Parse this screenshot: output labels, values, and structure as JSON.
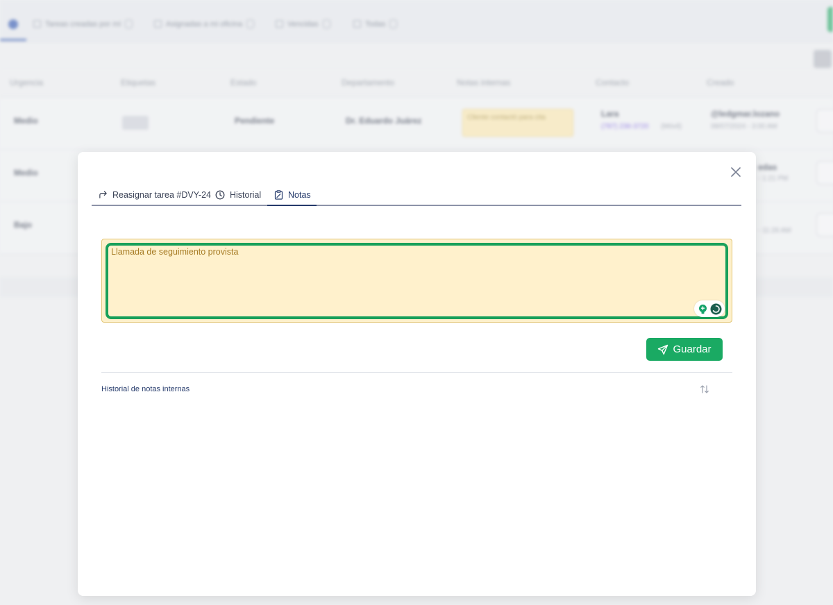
{
  "background": {
    "tabs": [
      {
        "label": "Tareas creadas por mí"
      },
      {
        "label": "Asignadas a mi oficina"
      },
      {
        "label": "Vencidas"
      },
      {
        "label": "Todas"
      }
    ],
    "columns": [
      "Urgencia",
      "Etiquetas",
      "Estado",
      "Departamento",
      "Notas internas",
      "Contacto",
      "Creado"
    ],
    "rows": [
      {
        "urgency": "Medio",
        "status": "Pendiente",
        "department": "Dr. Eduardo Juárez",
        "note": "Cliente contactó para cita",
        "contact": "Lara",
        "phone": "(787) 236-3720",
        "phone_suffix": "(Móvil)",
        "creator": "@ledgmar.lozano",
        "created": "08/07/2024 - 3:00 AM"
      },
      {
        "urgency": "Medio",
        "creator": "edas",
        "created": "- 1:21 PM"
      },
      {
        "urgency": "Bajo",
        "created": "- 11:26 AM"
      }
    ]
  },
  "modal": {
    "tabs": [
      {
        "label": "Reasignar tarea #DVY-24",
        "icon": "forward-arrow-icon"
      },
      {
        "label": "Historial",
        "icon": "clock-icon"
      },
      {
        "label": "Notas",
        "icon": "clipboard-note-icon"
      }
    ],
    "active_tab": "Notas",
    "note": {
      "value": "Llamada de seguimiento provista"
    },
    "save_label": "Guardar",
    "history_title": "Historial de notas internas"
  },
  "colors": {
    "accent_green": "#1aaa63",
    "focus_green": "#18a05a",
    "note_bg": "#fdf0cb",
    "navy": "#253a6b"
  }
}
